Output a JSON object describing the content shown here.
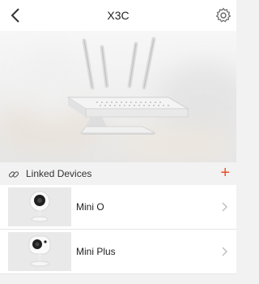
{
  "header": {
    "title": "X3C",
    "back_icon": "chevron-left-icon",
    "settings_icon": "gear-icon"
  },
  "hero": {
    "image": "router-with-antennas"
  },
  "linked_devices": {
    "label": "Linked Devices",
    "add_label": "+",
    "icon": "link-icon",
    "accent_color": "#f04b24",
    "items": [
      {
        "name": "Mini O",
        "thumb": "mini-o-camera"
      },
      {
        "name": "Mini Plus",
        "thumb": "mini-plus-camera"
      }
    ]
  }
}
